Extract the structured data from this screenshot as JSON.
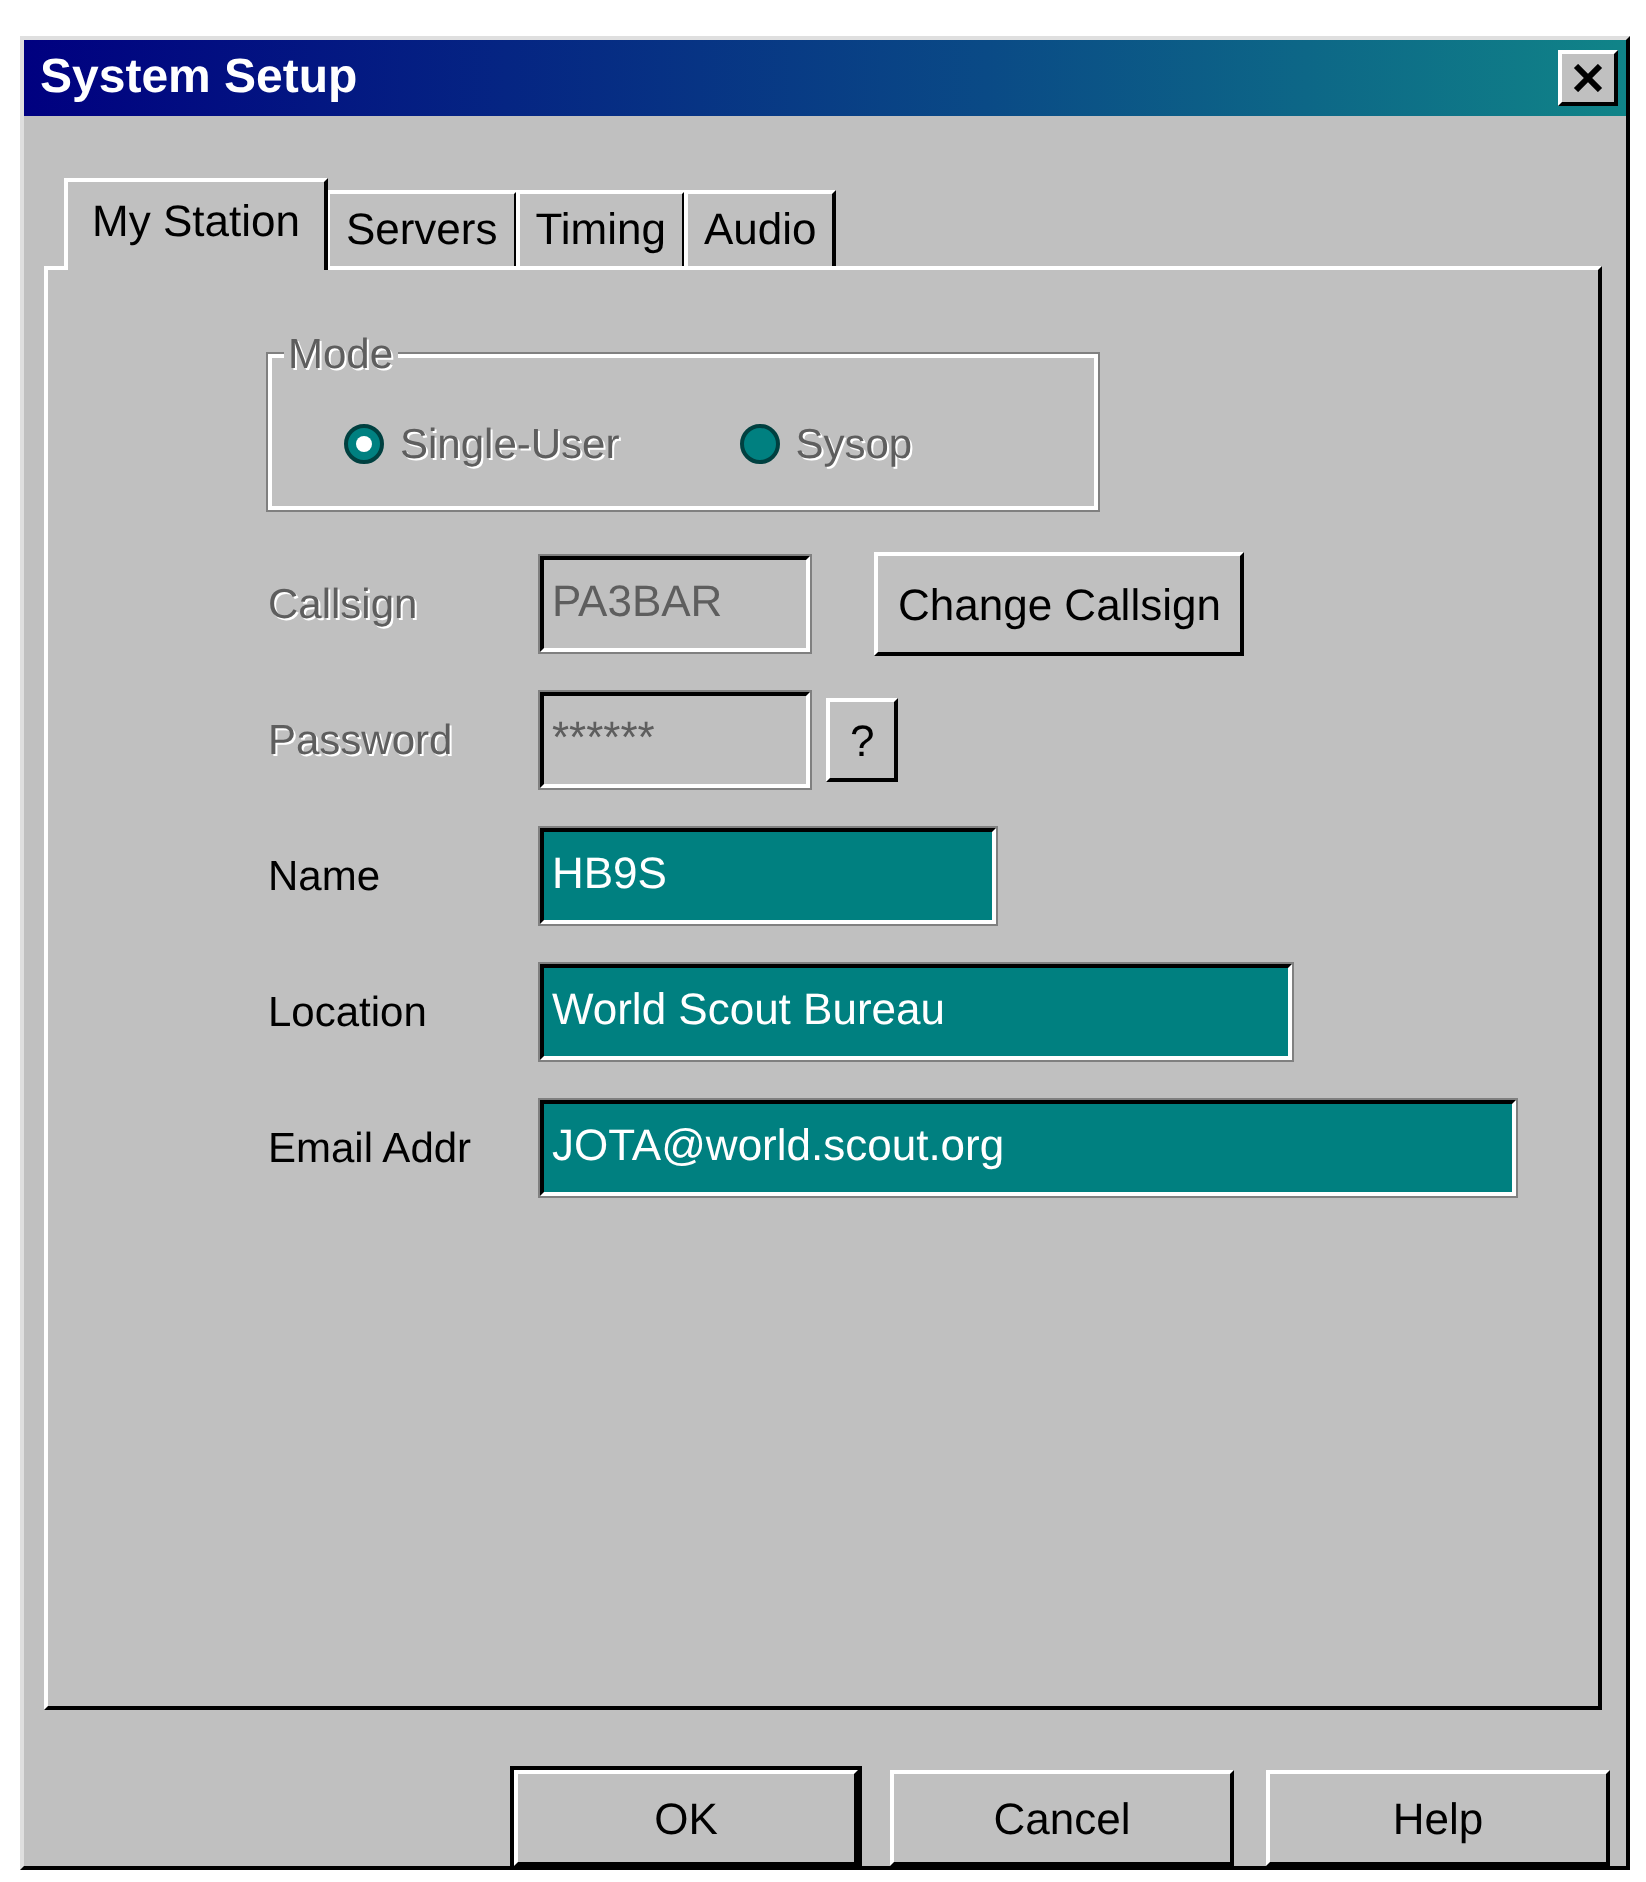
{
  "window": {
    "title": "System Setup"
  },
  "tabs": [
    {
      "label": "My Station",
      "selected": true
    },
    {
      "label": "Servers",
      "selected": false
    },
    {
      "label": "Timing",
      "selected": false
    },
    {
      "label": "Audio",
      "selected": false
    }
  ],
  "mode": {
    "label": "Mode",
    "disabled": true,
    "options": [
      {
        "label": "Single-User",
        "selected": true
      },
      {
        "label": "Sysop",
        "selected": false
      }
    ]
  },
  "fields": [
    {
      "label": "Callsign",
      "value": "PA3BAR",
      "disabled": true,
      "button": "Change Callsign"
    },
    {
      "label": "Password",
      "value": "******",
      "disabled": true,
      "button": "?"
    },
    {
      "label": "Name",
      "value": "HB9S",
      "disabled": false
    },
    {
      "label": "Location",
      "value": "World Scout Bureau",
      "disabled": false
    },
    {
      "label": "Email Addr",
      "value": "JOTA@world.scout.org",
      "disabled": false
    }
  ],
  "buttons": [
    {
      "label": "OK",
      "default": true
    },
    {
      "label": "Cancel",
      "default": false
    },
    {
      "label": "Help",
      "default": false
    }
  ]
}
